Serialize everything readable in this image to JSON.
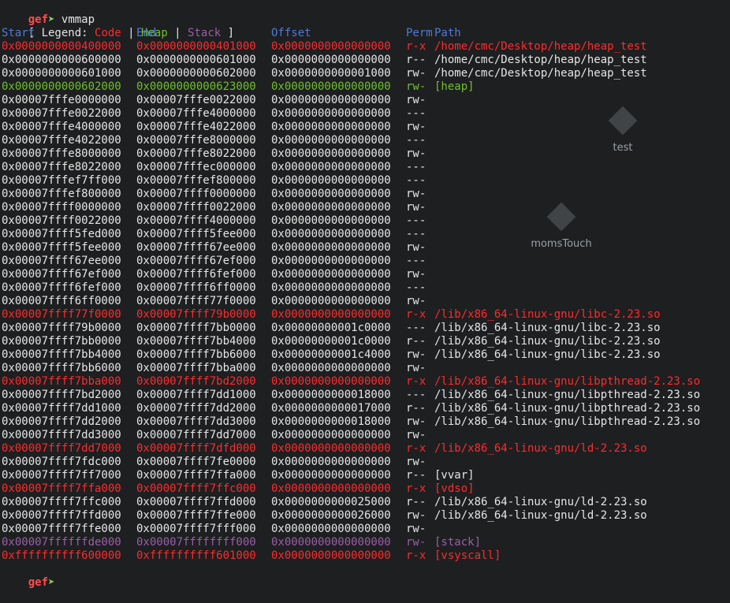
{
  "prompt": {
    "name": "gef",
    "arrow": "➤",
    "command": "vmmap"
  },
  "legend": {
    "open": "[ Legend: ",
    "code": "Code",
    "sep1": " | ",
    "heap": "Heap",
    "sep2": " | ",
    "stack": "Stack",
    "close": " ]"
  },
  "headers": {
    "start": "Start",
    "end": "End",
    "offset": "Offset",
    "perm": "Perm",
    "path": "Path"
  },
  "desktop_icons": {
    "test_label": "test",
    "moms_label": "momsTouch"
  },
  "rows": [
    {
      "start": "0x0000000000400000",
      "end": "0x0000000000401000",
      "offset": "0x0000000000000000",
      "perm": "r-x",
      "path": "/home/cmc/Desktop/heap/heap_test",
      "kind": "code"
    },
    {
      "start": "0x0000000000600000",
      "end": "0x0000000000601000",
      "offset": "0x0000000000000000",
      "perm": "r--",
      "path": "/home/cmc/Desktop/heap/heap_test",
      "kind": "plain"
    },
    {
      "start": "0x0000000000601000",
      "end": "0x0000000000602000",
      "offset": "0x0000000000001000",
      "perm": "rw-",
      "path": "/home/cmc/Desktop/heap/heap_test",
      "kind": "plain"
    },
    {
      "start": "0x0000000000602000",
      "end": "0x0000000000623000",
      "offset": "0x0000000000000000",
      "perm": "rw-",
      "path": "[heap]",
      "kind": "heap"
    },
    {
      "start": "0x00007fffe0000000",
      "end": "0x00007fffe0022000",
      "offset": "0x0000000000000000",
      "perm": "rw-",
      "path": "",
      "kind": "plain"
    },
    {
      "start": "0x00007fffe0022000",
      "end": "0x00007fffe4000000",
      "offset": "0x0000000000000000",
      "perm": "---",
      "path": "",
      "kind": "plain"
    },
    {
      "start": "0x00007fffe4000000",
      "end": "0x00007fffe4022000",
      "offset": "0x0000000000000000",
      "perm": "rw-",
      "path": "",
      "kind": "plain"
    },
    {
      "start": "0x00007fffe4022000",
      "end": "0x00007fffe8000000",
      "offset": "0x0000000000000000",
      "perm": "---",
      "path": "",
      "kind": "plain"
    },
    {
      "start": "0x00007fffe8000000",
      "end": "0x00007fffe8022000",
      "offset": "0x0000000000000000",
      "perm": "rw-",
      "path": "",
      "kind": "plain"
    },
    {
      "start": "0x00007fffe8022000",
      "end": "0x00007fffec000000",
      "offset": "0x0000000000000000",
      "perm": "---",
      "path": "",
      "kind": "plain"
    },
    {
      "start": "0x00007fffef7ff000",
      "end": "0x00007fffef800000",
      "offset": "0x0000000000000000",
      "perm": "---",
      "path": "",
      "kind": "plain"
    },
    {
      "start": "0x00007fffef800000",
      "end": "0x00007ffff0000000",
      "offset": "0x0000000000000000",
      "perm": "rw-",
      "path": "",
      "kind": "plain"
    },
    {
      "start": "0x00007ffff0000000",
      "end": "0x00007ffff0022000",
      "offset": "0x0000000000000000",
      "perm": "rw-",
      "path": "",
      "kind": "plain"
    },
    {
      "start": "0x00007ffff0022000",
      "end": "0x00007ffff4000000",
      "offset": "0x0000000000000000",
      "perm": "---",
      "path": "",
      "kind": "plain"
    },
    {
      "start": "0x00007ffff5fed000",
      "end": "0x00007ffff5fee000",
      "offset": "0x0000000000000000",
      "perm": "---",
      "path": "",
      "kind": "plain"
    },
    {
      "start": "0x00007ffff5fee000",
      "end": "0x00007ffff67ee000",
      "offset": "0x0000000000000000",
      "perm": "rw-",
      "path": "",
      "kind": "plain"
    },
    {
      "start": "0x00007ffff67ee000",
      "end": "0x00007ffff67ef000",
      "offset": "0x0000000000000000",
      "perm": "---",
      "path": "",
      "kind": "plain"
    },
    {
      "start": "0x00007ffff67ef000",
      "end": "0x00007ffff6fef000",
      "offset": "0x0000000000000000",
      "perm": "rw-",
      "path": "",
      "kind": "plain"
    },
    {
      "start": "0x00007ffff6fef000",
      "end": "0x00007ffff6ff0000",
      "offset": "0x0000000000000000",
      "perm": "---",
      "path": "",
      "kind": "plain"
    },
    {
      "start": "0x00007ffff6ff0000",
      "end": "0x00007ffff77f0000",
      "offset": "0x0000000000000000",
      "perm": "rw-",
      "path": "",
      "kind": "plain"
    },
    {
      "start": "0x00007ffff77f0000",
      "end": "0x00007ffff79b0000",
      "offset": "0x0000000000000000",
      "perm": "r-x",
      "path": "/lib/x86_64-linux-gnu/libc-2.23.so",
      "kind": "code"
    },
    {
      "start": "0x00007ffff79b0000",
      "end": "0x00007ffff7bb0000",
      "offset": "0x00000000001c0000",
      "perm": "---",
      "path": "/lib/x86_64-linux-gnu/libc-2.23.so",
      "kind": "plain"
    },
    {
      "start": "0x00007ffff7bb0000",
      "end": "0x00007ffff7bb4000",
      "offset": "0x00000000001c0000",
      "perm": "r--",
      "path": "/lib/x86_64-linux-gnu/libc-2.23.so",
      "kind": "plain"
    },
    {
      "start": "0x00007ffff7bb4000",
      "end": "0x00007ffff7bb6000",
      "offset": "0x00000000001c4000",
      "perm": "rw-",
      "path": "/lib/x86_64-linux-gnu/libc-2.23.so",
      "kind": "plain"
    },
    {
      "start": "0x00007ffff7bb6000",
      "end": "0x00007ffff7bba000",
      "offset": "0x0000000000000000",
      "perm": "rw-",
      "path": "",
      "kind": "plain"
    },
    {
      "start": "0x00007ffff7bba000",
      "end": "0x00007ffff7bd2000",
      "offset": "0x0000000000000000",
      "perm": "r-x",
      "path": "/lib/x86_64-linux-gnu/libpthread-2.23.so",
      "kind": "code"
    },
    {
      "start": "0x00007ffff7bd2000",
      "end": "0x00007ffff7dd1000",
      "offset": "0x0000000000018000",
      "perm": "---",
      "path": "/lib/x86_64-linux-gnu/libpthread-2.23.so",
      "kind": "plain"
    },
    {
      "start": "0x00007ffff7dd1000",
      "end": "0x00007ffff7dd2000",
      "offset": "0x0000000000017000",
      "perm": "r--",
      "path": "/lib/x86_64-linux-gnu/libpthread-2.23.so",
      "kind": "plain"
    },
    {
      "start": "0x00007ffff7dd2000",
      "end": "0x00007ffff7dd3000",
      "offset": "0x0000000000018000",
      "perm": "rw-",
      "path": "/lib/x86_64-linux-gnu/libpthread-2.23.so",
      "kind": "plain"
    },
    {
      "start": "0x00007ffff7dd3000",
      "end": "0x00007ffff7dd7000",
      "offset": "0x0000000000000000",
      "perm": "rw-",
      "path": "",
      "kind": "plain"
    },
    {
      "start": "0x00007ffff7dd7000",
      "end": "0x00007ffff7dfd000",
      "offset": "0x0000000000000000",
      "perm": "r-x",
      "path": "/lib/x86_64-linux-gnu/ld-2.23.so",
      "kind": "code"
    },
    {
      "start": "0x00007ffff7fdc000",
      "end": "0x00007ffff7fe0000",
      "offset": "0x0000000000000000",
      "perm": "rw-",
      "path": "",
      "kind": "plain"
    },
    {
      "start": "0x00007ffff7ff7000",
      "end": "0x00007ffff7ffa000",
      "offset": "0x0000000000000000",
      "perm": "r--",
      "path": "[vvar]",
      "kind": "plain"
    },
    {
      "start": "0x00007ffff7ffa000",
      "end": "0x00007ffff7ffc000",
      "offset": "0x0000000000000000",
      "perm": "r-x",
      "path": "[vdso]",
      "kind": "code"
    },
    {
      "start": "0x00007ffff7ffc000",
      "end": "0x00007ffff7ffd000",
      "offset": "0x0000000000025000",
      "perm": "r--",
      "path": "/lib/x86_64-linux-gnu/ld-2.23.so",
      "kind": "plain"
    },
    {
      "start": "0x00007ffff7ffd000",
      "end": "0x00007ffff7ffe000",
      "offset": "0x0000000000026000",
      "perm": "rw-",
      "path": "/lib/x86_64-linux-gnu/ld-2.23.so",
      "kind": "plain"
    },
    {
      "start": "0x00007ffff7ffe000",
      "end": "0x00007ffff7fff000",
      "offset": "0x0000000000000000",
      "perm": "rw-",
      "path": "",
      "kind": "plain"
    },
    {
      "start": "0x00007ffffffde000",
      "end": "0x00007ffffffff000",
      "offset": "0x0000000000000000",
      "perm": "rw-",
      "path": "[stack]",
      "kind": "stack"
    },
    {
      "start": "0xffffffffff600000",
      "end": "0xffffffffff601000",
      "offset": "0x0000000000000000",
      "perm": "r-x",
      "path": "[vsyscall]",
      "kind": "code"
    }
  ],
  "colors": {
    "code": "#ff2b2b",
    "heap": "#6ec12a",
    "stack": "#9a5fa6",
    "plain": "#e6e6e6",
    "header": "#4f7bd8",
    "prompt": "#ff4d4d",
    "arrow": "#8bd84b",
    "background": "#1e1f21"
  }
}
